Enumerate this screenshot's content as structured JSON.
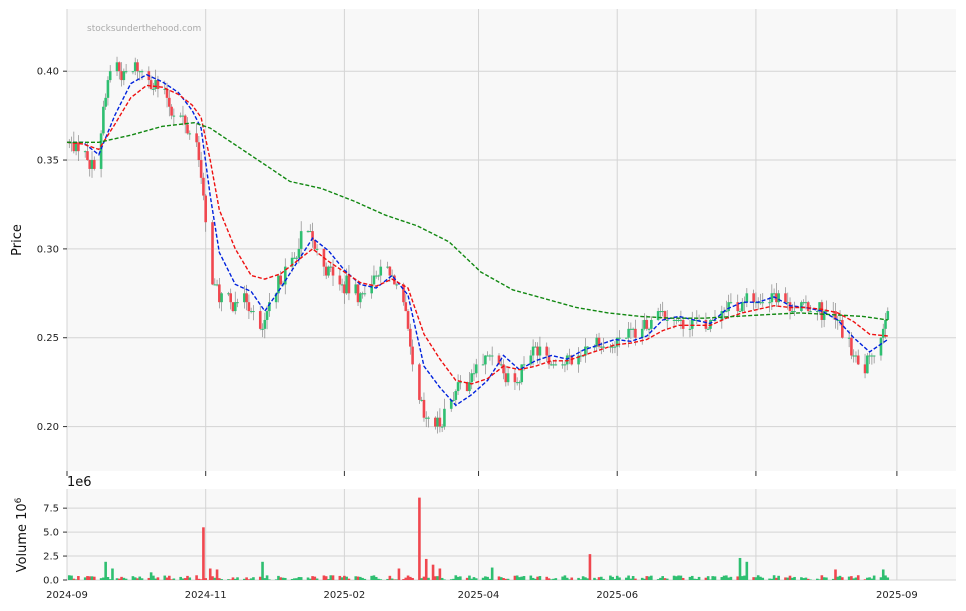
{
  "chart_data": [
    {
      "type": "candlestick",
      "watermark": "stocksunderthehood.com",
      "ylabel": "Price",
      "ylim": [
        0.175,
        0.435
      ],
      "yticks": [
        0.2,
        0.25,
        0.3,
        0.35,
        0.4
      ],
      "ytick_labels": [
        "0.20",
        "0.25",
        "0.30",
        "0.35",
        "0.40"
      ],
      "x_start": "2024-09-01",
      "x_end": "2025-09-27",
      "xticks": [
        "2024-09-01",
        "2024-11-01",
        "2025-01-01",
        "2025-03-01",
        "2025-05-01",
        "2025-07-01",
        "2025-09-01"
      ],
      "xtick_labels": [
        "2024-09",
        "2024-11",
        "2025-02",
        "2025-04",
        "2025-06",
        "2025-09"
      ],
      "xtick_label_dates": [
        "2024-09-01",
        "2024-11-01",
        "2025-01-01",
        "2025-03-01",
        "2025-05-01",
        "2025-09-01"
      ],
      "grid": true,
      "up_color": "#2fbf71",
      "down_color": "#f0474f",
      "close_path": [
        [
          "2024-09-01",
          0.36
        ],
        [
          "2024-09-08",
          0.355
        ],
        [
          "2024-09-12",
          0.348
        ],
        [
          "2024-09-15",
          0.356
        ],
        [
          "2024-09-18",
          0.385
        ],
        [
          "2024-09-21",
          0.41
        ],
        [
          "2024-09-26",
          0.398
        ],
        [
          "2024-10-02",
          0.402
        ],
        [
          "2024-10-08",
          0.395
        ],
        [
          "2024-10-13",
          0.388
        ],
        [
          "2024-10-18",
          0.378
        ],
        [
          "2024-10-23",
          0.37
        ],
        [
          "2024-10-28",
          0.362
        ],
        [
          "2024-10-30",
          0.34
        ],
        [
          "2024-11-03",
          0.285
        ],
        [
          "2024-11-07",
          0.272
        ],
        [
          "2024-11-12",
          0.27
        ],
        [
          "2024-11-17",
          0.275
        ],
        [
          "2024-11-21",
          0.268
        ],
        [
          "2024-11-25",
          0.252
        ],
        [
          "2024-11-29",
          0.265
        ],
        [
          "2024-12-04",
          0.283
        ],
        [
          "2024-12-09",
          0.29
        ],
        [
          "2024-12-14",
          0.31
        ],
        [
          "2024-12-19",
          0.303
        ],
        [
          "2024-12-24",
          0.29
        ],
        [
          "2024-12-29",
          0.282
        ],
        [
          "2025-01-03",
          0.278
        ],
        [
          "2025-01-08",
          0.272
        ],
        [
          "2025-01-13",
          0.282
        ],
        [
          "2025-01-18",
          0.29
        ],
        [
          "2025-01-23",
          0.283
        ],
        [
          "2025-01-28",
          0.262
        ],
        [
          "2025-02-01",
          0.225
        ],
        [
          "2025-02-05",
          0.205
        ],
        [
          "2025-02-10",
          0.2
        ],
        [
          "2025-02-15",
          0.21
        ],
        [
          "2025-02-20",
          0.222
        ],
        [
          "2025-02-26",
          0.228
        ],
        [
          "2025-03-03",
          0.237
        ],
        [
          "2025-03-08",
          0.243
        ],
        [
          "2025-03-13",
          0.23
        ],
        [
          "2025-03-18",
          0.226
        ],
        [
          "2025-03-23",
          0.24
        ],
        [
          "2025-03-28",
          0.245
        ],
        [
          "2025-04-02",
          0.236
        ],
        [
          "2025-04-08",
          0.236
        ],
        [
          "2025-04-13",
          0.24
        ],
        [
          "2025-04-18",
          0.245
        ],
        [
          "2025-04-23",
          0.247
        ],
        [
          "2025-04-28",
          0.246
        ],
        [
          "2025-05-04",
          0.252
        ],
        [
          "2025-05-09",
          0.25
        ],
        [
          "2025-05-14",
          0.256
        ],
        [
          "2025-05-19",
          0.268
        ],
        [
          "2025-05-24",
          0.262
        ],
        [
          "2025-05-29",
          0.257
        ],
        [
          "2025-06-03",
          0.26
        ],
        [
          "2025-06-08",
          0.255
        ],
        [
          "2025-06-13",
          0.262
        ],
        [
          "2025-06-18",
          0.27
        ],
        [
          "2025-06-24",
          0.268
        ],
        [
          "2025-06-29",
          0.273
        ],
        [
          "2025-07-04",
          0.27
        ],
        [
          "2025-07-09",
          0.276
        ],
        [
          "2025-07-14",
          0.27
        ],
        [
          "2025-07-19",
          0.268
        ],
        [
          "2025-07-24",
          0.267
        ],
        [
          "2025-07-29",
          0.266
        ],
        [
          "2025-08-03",
          0.263
        ],
        [
          "2025-08-08",
          0.255
        ],
        [
          "2025-08-13",
          0.238
        ],
        [
          "2025-08-17",
          0.232
        ],
        [
          "2025-08-21",
          0.24
        ],
        [
          "2025-08-25",
          0.25
        ],
        [
          "2025-08-28",
          0.268
        ]
      ],
      "series": [
        {
          "color": "#0022dd",
          "points": [
            [
              "2024-09-01",
              0.36
            ],
            [
              "2024-09-08",
              0.36
            ],
            [
              "2024-09-15",
              0.353
            ],
            [
              "2024-09-22",
              0.375
            ],
            [
              "2024-09-29",
              0.393
            ],
            [
              "2024-10-06",
              0.398
            ],
            [
              "2024-10-13",
              0.394
            ],
            [
              "2024-10-20",
              0.388
            ],
            [
              "2024-10-26",
              0.378
            ],
            [
              "2024-10-30",
              0.368
            ],
            [
              "2024-11-03",
              0.33
            ],
            [
              "2024-11-07",
              0.298
            ],
            [
              "2024-11-14",
              0.28
            ],
            [
              "2024-11-21",
              0.276
            ],
            [
              "2024-11-27",
              0.265
            ],
            [
              "2024-12-04",
              0.278
            ],
            [
              "2024-12-11",
              0.292
            ],
            [
              "2024-12-18",
              0.306
            ],
            [
              "2024-12-25",
              0.299
            ],
            [
              "2025-01-01",
              0.288
            ],
            [
              "2025-01-08",
              0.28
            ],
            [
              "2025-01-15",
              0.278
            ],
            [
              "2025-01-22",
              0.285
            ],
            [
              "2025-01-29",
              0.274
            ],
            [
              "2025-02-05",
              0.234
            ],
            [
              "2025-02-12",
              0.222
            ],
            [
              "2025-02-19",
              0.212
            ],
            [
              "2025-02-26",
              0.218
            ],
            [
              "2025-03-05",
              0.226
            ],
            [
              "2025-03-12",
              0.24
            ],
            [
              "2025-03-19",
              0.232
            ],
            [
              "2025-03-26",
              0.237
            ],
            [
              "2025-04-02",
              0.24
            ],
            [
              "2025-04-09",
              0.238
            ],
            [
              "2025-04-16",
              0.243
            ],
            [
              "2025-04-23",
              0.246
            ],
            [
              "2025-04-30",
              0.249
            ],
            [
              "2025-05-07",
              0.248
            ],
            [
              "2025-05-14",
              0.251
            ],
            [
              "2025-05-21",
              0.26
            ],
            [
              "2025-05-28",
              0.262
            ],
            [
              "2025-06-04",
              0.26
            ],
            [
              "2025-06-11",
              0.258
            ],
            [
              "2025-06-18",
              0.266
            ],
            [
              "2025-06-25",
              0.27
            ],
            [
              "2025-07-02",
              0.27
            ],
            [
              "2025-07-09",
              0.273
            ],
            [
              "2025-07-16",
              0.268
            ],
            [
              "2025-07-23",
              0.267
            ],
            [
              "2025-07-30",
              0.265
            ],
            [
              "2025-08-06",
              0.26
            ],
            [
              "2025-08-13",
              0.25
            ],
            [
              "2025-08-20",
              0.242
            ],
            [
              "2025-08-28",
              0.249
            ]
          ]
        },
        {
          "color": "#ee1111",
          "points": [
            [
              "2024-09-01",
              0.36
            ],
            [
              "2024-09-08",
              0.359
            ],
            [
              "2024-09-15",
              0.356
            ],
            [
              "2024-09-22",
              0.37
            ],
            [
              "2024-09-29",
              0.385
            ],
            [
              "2024-10-06",
              0.392
            ],
            [
              "2024-10-13",
              0.391
            ],
            [
              "2024-10-20",
              0.387
            ],
            [
              "2024-10-26",
              0.381
            ],
            [
              "2024-10-30",
              0.374
            ],
            [
              "2024-11-03",
              0.35
            ],
            [
              "2024-11-07",
              0.322
            ],
            [
              "2024-11-14",
              0.3
            ],
            [
              "2024-11-21",
              0.285
            ],
            [
              "2024-11-27",
              0.283
            ],
            [
              "2024-12-04",
              0.286
            ],
            [
              "2024-12-11",
              0.293
            ],
            [
              "2024-12-18",
              0.3
            ],
            [
              "2024-12-25",
              0.293
            ],
            [
              "2025-01-01",
              0.287
            ],
            [
              "2025-01-08",
              0.281
            ],
            [
              "2025-01-15",
              0.279
            ],
            [
              "2025-01-22",
              0.283
            ],
            [
              "2025-01-29",
              0.278
            ],
            [
              "2025-02-05",
              0.252
            ],
            [
              "2025-02-12",
              0.238
            ],
            [
              "2025-02-19",
              0.226
            ],
            [
              "2025-02-26",
              0.224
            ],
            [
              "2025-03-05",
              0.227
            ],
            [
              "2025-03-12",
              0.234
            ],
            [
              "2025-03-19",
              0.232
            ],
            [
              "2025-03-26",
              0.234
            ],
            [
              "2025-04-02",
              0.237
            ],
            [
              "2025-04-09",
              0.237
            ],
            [
              "2025-04-16",
              0.24
            ],
            [
              "2025-04-23",
              0.243
            ],
            [
              "2025-04-30",
              0.246
            ],
            [
              "2025-05-07",
              0.247
            ],
            [
              "2025-05-14",
              0.249
            ],
            [
              "2025-05-21",
              0.254
            ],
            [
              "2025-05-28",
              0.257
            ],
            [
              "2025-06-04",
              0.257
            ],
            [
              "2025-06-11",
              0.257
            ],
            [
              "2025-06-18",
              0.261
            ],
            [
              "2025-06-25",
              0.264
            ],
            [
              "2025-07-02",
              0.266
            ],
            [
              "2025-07-09",
              0.268
            ],
            [
              "2025-07-16",
              0.267
            ],
            [
              "2025-07-23",
              0.267
            ],
            [
              "2025-07-30",
              0.266
            ],
            [
              "2025-08-06",
              0.264
            ],
            [
              "2025-08-13",
              0.259
            ],
            [
              "2025-08-20",
              0.252
            ],
            [
              "2025-08-28",
              0.251
            ]
          ]
        },
        {
          "color": "#118811",
          "points": [
            [
              "2024-09-01",
              0.36
            ],
            [
              "2024-09-15",
              0.36
            ],
            [
              "2024-09-29",
              0.364
            ],
            [
              "2024-10-13",
              0.369
            ],
            [
              "2024-10-27",
              0.371
            ],
            [
              "2024-11-03",
              0.368
            ],
            [
              "2024-11-17",
              0.356
            ],
            [
              "2024-12-01",
              0.344
            ],
            [
              "2024-12-08",
              0.338
            ],
            [
              "2024-12-22",
              0.334
            ],
            [
              "2025-01-05",
              0.327
            ],
            [
              "2025-01-19",
              0.319
            ],
            [
              "2025-02-02",
              0.313
            ],
            [
              "2025-02-16",
              0.304
            ],
            [
              "2025-03-02",
              0.287
            ],
            [
              "2025-03-16",
              0.277
            ],
            [
              "2025-03-30",
              0.272
            ],
            [
              "2025-04-13",
              0.267
            ],
            [
              "2025-04-27",
              0.264
            ],
            [
              "2025-05-11",
              0.262
            ],
            [
              "2025-05-25",
              0.261
            ],
            [
              "2025-06-08",
              0.261
            ],
            [
              "2025-06-22",
              0.262
            ],
            [
              "2025-07-06",
              0.263
            ],
            [
              "2025-07-20",
              0.264
            ],
            [
              "2025-08-03",
              0.263
            ],
            [
              "2025-08-17",
              0.262
            ],
            [
              "2025-08-28",
              0.26
            ]
          ]
        }
      ]
    },
    {
      "type": "bar",
      "ylabel": "Volume  10",
      "ylabel_superscript": "6",
      "offset_text": "1e6",
      "ylim": [
        0,
        9.5
      ],
      "yticks": [
        0.0,
        2.5,
        5.0,
        7.5
      ],
      "ytick_labels": [
        "0.0",
        "2.5",
        "5.0",
        "7.5"
      ],
      "volume_spikes": [
        [
          "2024-09-18",
          1.9,
          "up"
        ],
        [
          "2024-09-21",
          1.2,
          "up"
        ],
        [
          "2024-10-08",
          0.8,
          "up"
        ],
        [
          "2024-10-31",
          5.5,
          "down"
        ],
        [
          "2024-11-03",
          1.2,
          "down"
        ],
        [
          "2024-11-06",
          1.1,
          "down"
        ],
        [
          "2024-11-26",
          1.9,
          "up"
        ],
        [
          "2025-01-25",
          1.2,
          "down"
        ],
        [
          "2025-02-03",
          8.6,
          "down"
        ],
        [
          "2025-02-06",
          2.2,
          "down"
        ],
        [
          "2025-02-09",
          1.6,
          "down"
        ],
        [
          "2025-02-12",
          1.2,
          "down"
        ],
        [
          "2025-03-07",
          1.3,
          "up"
        ],
        [
          "2025-04-19",
          2.7,
          "down"
        ],
        [
          "2025-06-24",
          2.3,
          "up"
        ],
        [
          "2025-06-27",
          1.9,
          "up"
        ],
        [
          "2025-08-05",
          1.1,
          "down"
        ],
        [
          "2025-08-26",
          1.1,
          "up"
        ]
      ]
    }
  ]
}
